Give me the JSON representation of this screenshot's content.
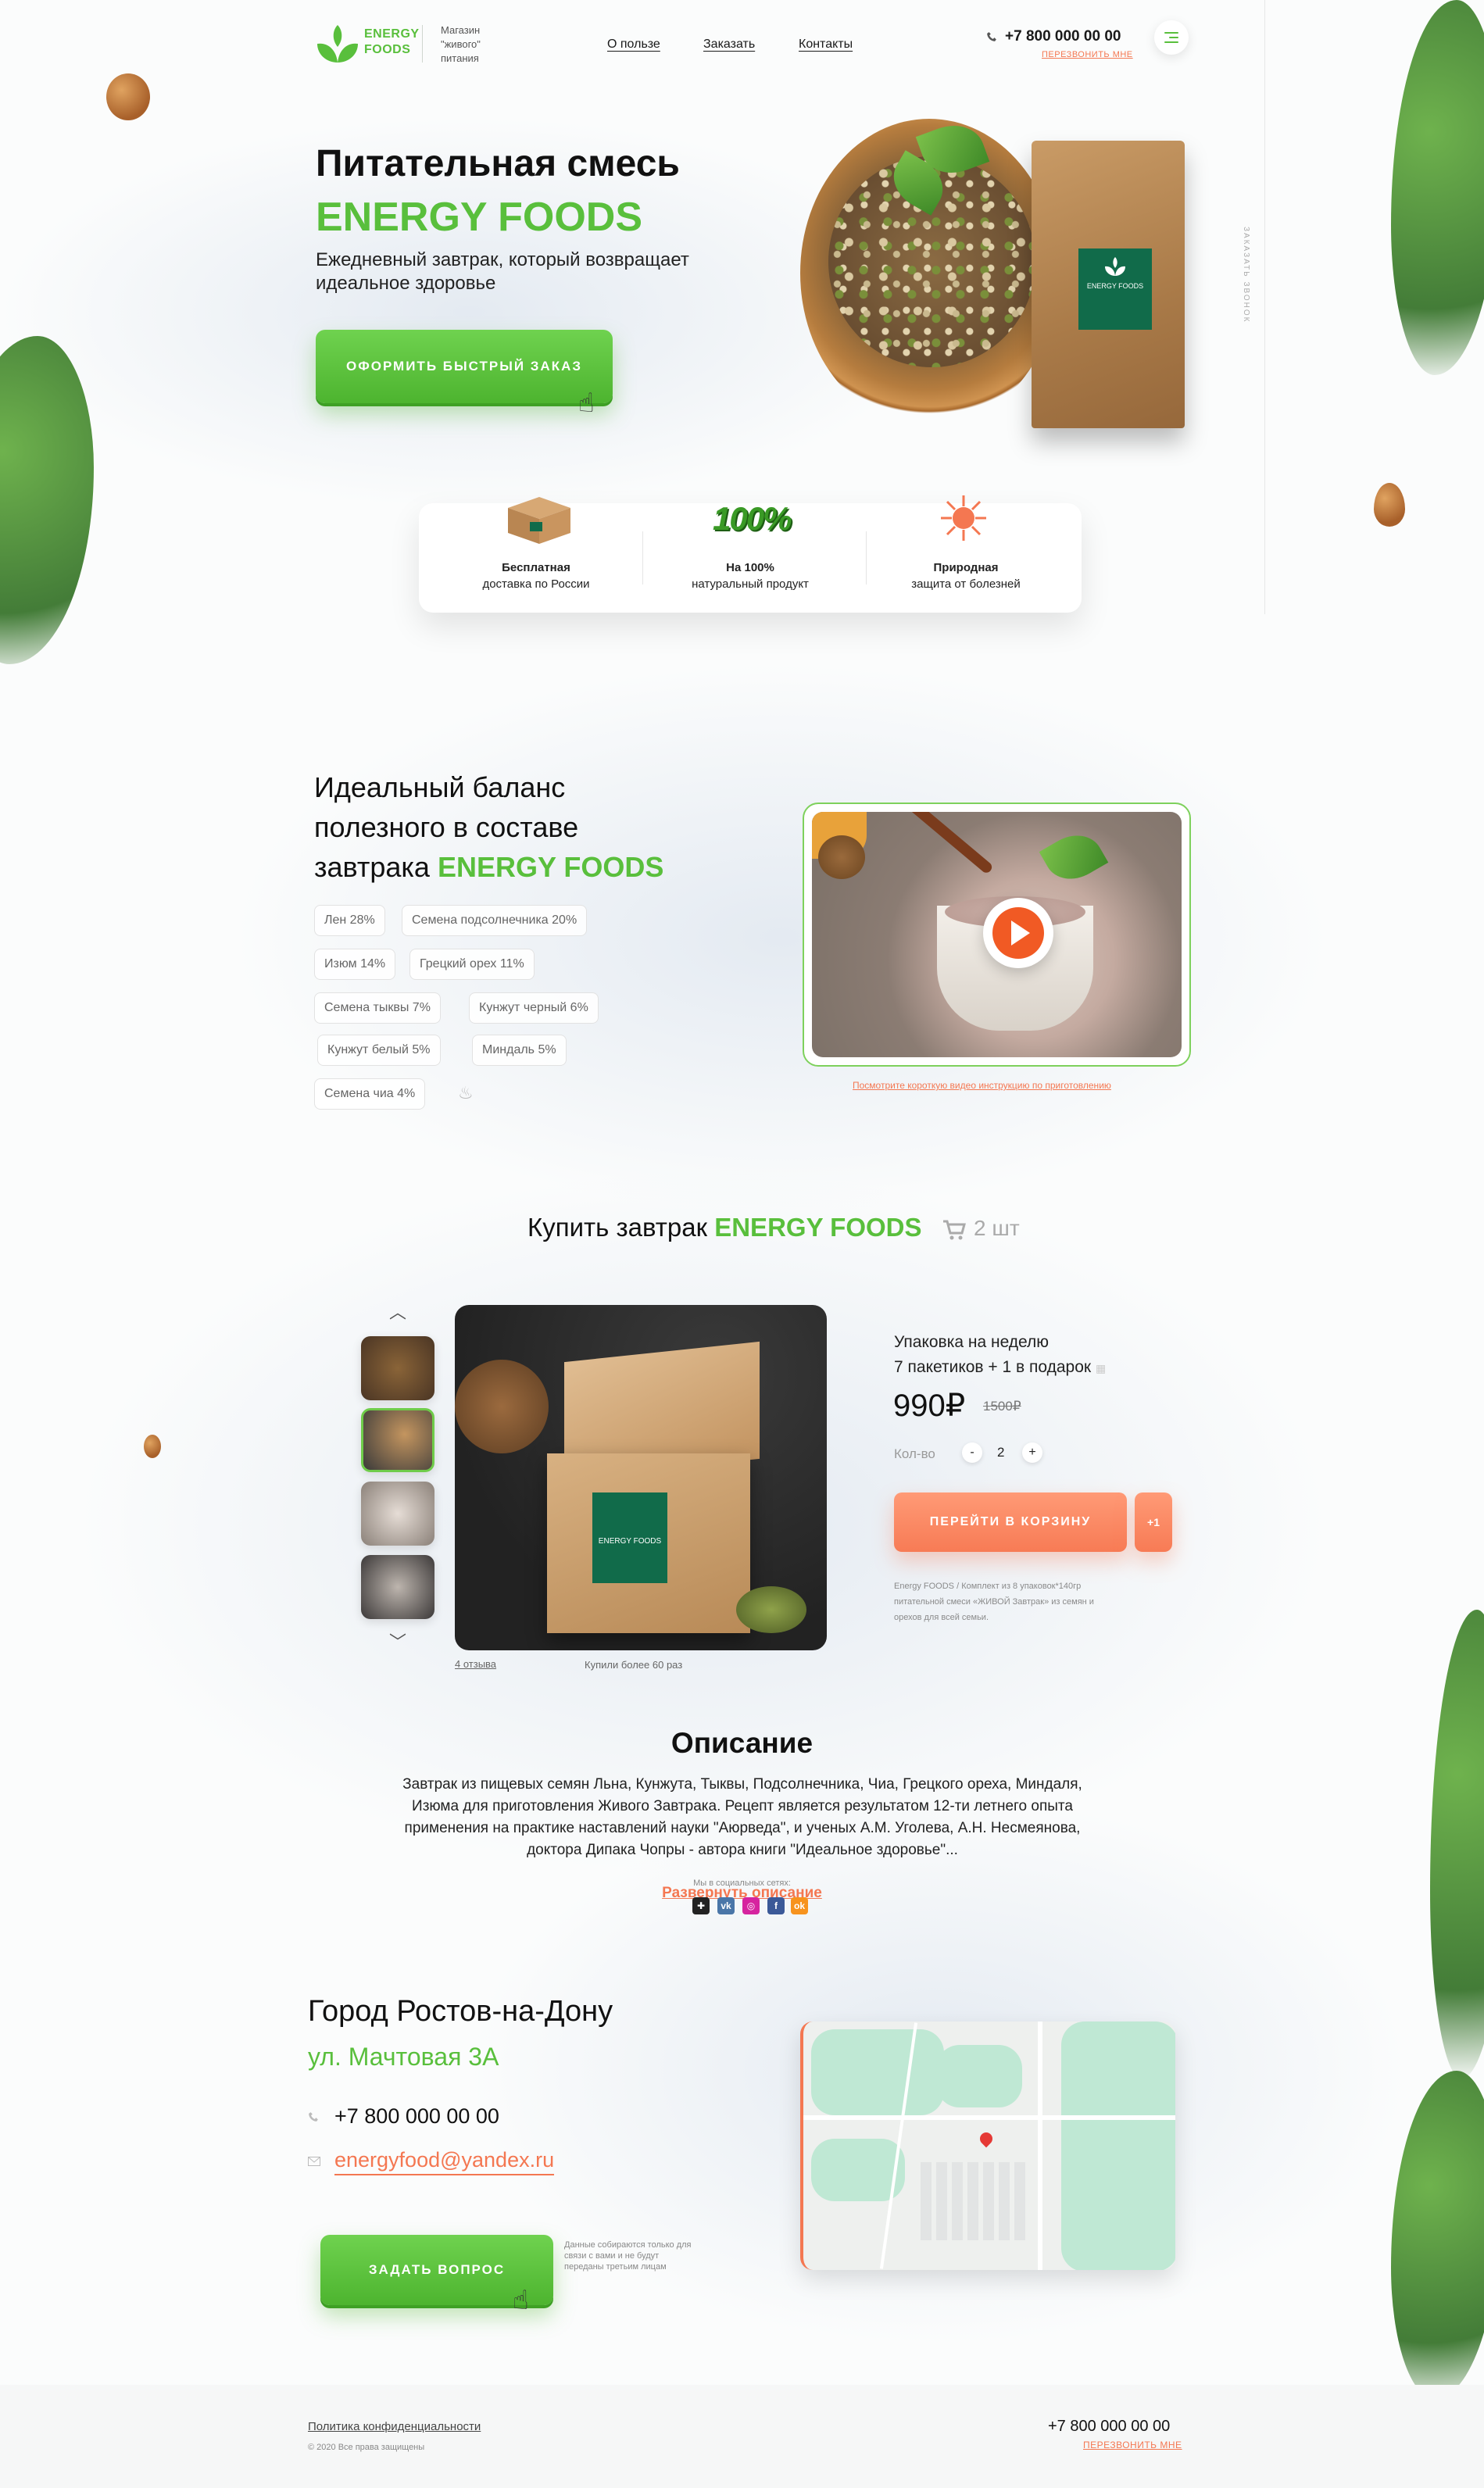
{
  "brand": {
    "name_line1": "ENERGY",
    "name_line2": "FOODS",
    "tagline": "Магазин \"живого\" питания"
  },
  "nav": {
    "items": [
      "О пользе",
      "Заказать",
      "Контакты"
    ]
  },
  "header": {
    "phone": "+7 800 000 00 00",
    "callback": "ПЕРЕЗВОНИТЬ МНЕ",
    "side_text": "ЗАКАЗАТЬ ЗВОНОК"
  },
  "hero": {
    "title_line1": "Питательная смесь",
    "title_line2": "ENERGY FOODS",
    "subtitle": "Ежедневный завтрак, который возвращает идеальное здоровье",
    "cta": "ОФОРМИТЬ БЫСТРЫЙ ЗАКАЗ",
    "pack_label": "ENERGY FOODS"
  },
  "features": [
    {
      "title": "Бесплатная",
      "text": "доставка по России"
    },
    {
      "title": "На 100%",
      "text": "натуральный продукт"
    },
    {
      "title": "Природная",
      "text": "защита от болезней"
    }
  ],
  "features_badge": "100%",
  "balance": {
    "title_line1": "Идеальный баланс",
    "title_line2": "полезного в составе",
    "title_line3_prefix": "завтрака ",
    "title_line3_brand": "ENERGY FOODS",
    "ingredients": [
      "Лен 28%",
      "Семена подсолнечника 20%",
      "Изюм 14%",
      "Грецкий орех 11%",
      "Семена тыквы 7%",
      "Кунжут черный 6%",
      "Кунжут белый 5%",
      "Миндаль 5%",
      "Семена чиа 4%"
    ],
    "video_link": "Посмотрите короткую видео инструкцию по приготовлению"
  },
  "buy": {
    "title_prefix": "Купить завтрак ",
    "title_brand": "ENERGY FOODS",
    "cart_count": "2 шт",
    "pack_line1": "Упаковка на неделю",
    "pack_line2": "7 пакетиков + 1 в подарок",
    "price": "990₽",
    "old_price": "1500₽",
    "qty_label": "Кол-во",
    "qty_minus": "-",
    "qty_value": "2",
    "qty_plus": "+",
    "cart_button": "ПЕРЕЙТИ В КОРЗИНУ",
    "plus_one": "+1",
    "note": "Energy FOODS / Комплект из 8 упаковок*140гр питательной смеси «ЖИВОЙ Завтрак» из семян и орехов для всей семьи.",
    "reviews": "4 отзыва",
    "bought": "Купили более 60 раз",
    "box_label": "ENERGY FOODS"
  },
  "description": {
    "title": "Описание",
    "text": "Завтрак из пищевых семян Льна, Кунжута, Тыквы, Подсолнечника, Чиа, Грецкого ореха, Миндаля, Изюма для приготовления Живого Завтрака. Рецепт является результатом 12-ти летнего опыта применения на практике наставлений науки \"Аюрведа\", и ученых А.М. Уголева, А.Н. Несмеянова, доктора Дипака Чопры - автора книги \"Идеальное здоровье\"...",
    "social_label": "Мы в социальных сетях:",
    "expand": "Развернуть описание"
  },
  "contacts": {
    "city": "Город Ростов-на-Дону",
    "street": "ул. Мачтовая 3А",
    "phone": "+7 800 000 00 00",
    "email": "energyfood@yandex.ru",
    "ask_button": "ЗАДАТЬ ВОПРОС",
    "privacy_note": "Данные собираются только для связи с вами и не будут переданы третьим лицам"
  },
  "footer": {
    "privacy": "Политика конфиденциальности",
    "copyright": "© 2020 Все права защищены",
    "phone": "+7 800 000 00 00",
    "callback": "ПЕРЕЗВОНИТЬ МНЕ"
  },
  "colors": {
    "accent_green": "#59bf3c",
    "accent_orange": "#f47751"
  }
}
